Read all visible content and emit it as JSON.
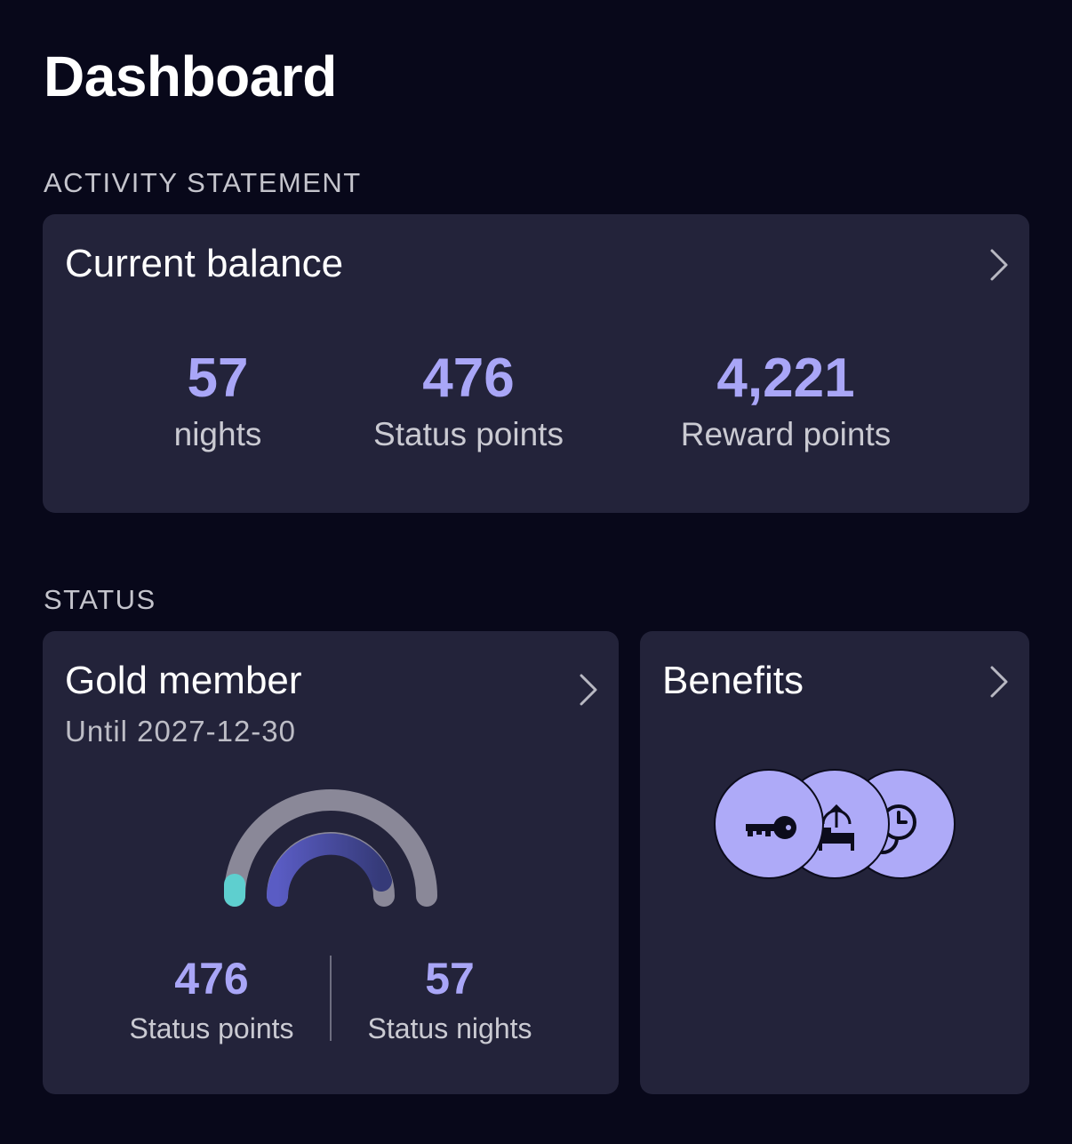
{
  "header": {
    "title": "Dashboard"
  },
  "activity": {
    "section_label": "ACTIVITY STATEMENT",
    "card_title": "Current balance",
    "stats": [
      {
        "value": "57",
        "label": "nights"
      },
      {
        "value": "476",
        "label": "Status points"
      },
      {
        "value": "4,221",
        "label": "Reward points"
      }
    ]
  },
  "status": {
    "section_label": "STATUS",
    "member_card": {
      "title": "Gold member",
      "subtitle": "Until 2027-12-30",
      "points": {
        "value": "476",
        "label": "Status points"
      },
      "nights": {
        "value": "57",
        "label": "Status nights"
      }
    },
    "benefits_card": {
      "title": "Benefits",
      "icons": [
        "key-icon",
        "room-upgrade-icon",
        "late-checkout-icon"
      ]
    }
  },
  "colors": {
    "background": "#08081a",
    "card": "#23233a",
    "accent": "#a9a6f7",
    "progress_teal": "#5ecfcf",
    "progress_indigo": "#5a5cc0",
    "track_gray": "#8a8898"
  }
}
